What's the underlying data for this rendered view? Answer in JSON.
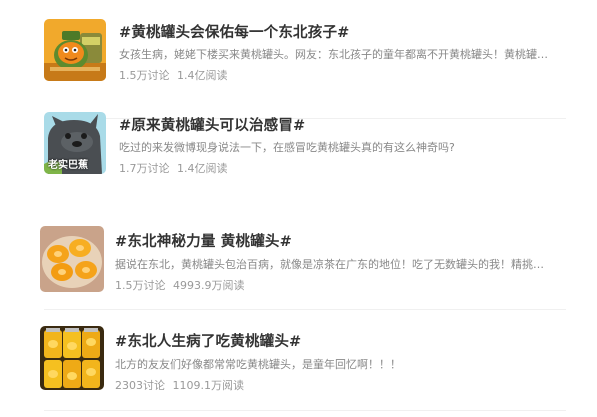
{
  "topics": [
    {
      "title": "#黄桃罐头会保佑每一个东北孩子#",
      "desc": "女孩生病，姥姥下楼买来黄桃罐头。网友：东北孩子的童年都离不开黄桃罐头！黄桃罐头会...",
      "discuss": "1.5万讨论",
      "read": "1.4亿阅读",
      "thumb_icon": "peach-can-cartoon-icon"
    },
    {
      "title": "#原来黄桃罐头可以治感冒#",
      "desc": "吃过的来发微博现身说法一下，在感冒吃黄桃罐头真的有这么神奇吗?",
      "discuss": "1.7万讨论",
      "read": "1.4亿阅读",
      "thumb_icon": "cartoon-creature-icon",
      "thumb_caption": "老实巴蕉"
    },
    {
      "title": "#东北神秘力量 黄桃罐头#",
      "desc": "据说在东北，黄桃罐头包治百病，就像是凉茶在广东的地位！吃了无数罐头的我！精挑细选...",
      "discuss": "1.5万讨论",
      "read": "4993.9万阅读",
      "thumb_icon": "peach-slices-bowl-icon"
    },
    {
      "title": "#东北人生病了吃黄桃罐头#",
      "desc": "北方的友友们好像都常常吃黄桃罐头，是童年回忆啊！！！",
      "discuss": "2303讨论",
      "read": "1109.1万阅读",
      "thumb_icon": "peach-jars-icon"
    }
  ]
}
